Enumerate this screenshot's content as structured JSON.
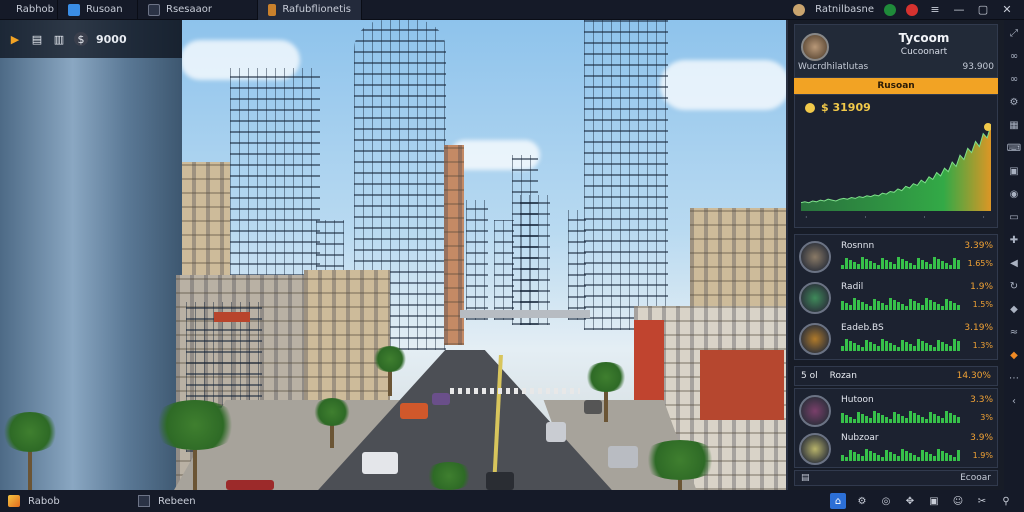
{
  "topbar": {
    "tabs": [
      {
        "label": "Rabhob",
        "icon": "app-logo-icon"
      },
      {
        "label": "Rusoan",
        "icon": "home-icon"
      },
      {
        "label": "Rsesaaor",
        "icon": "grid-icon"
      },
      {
        "label": "Rafubflionetis",
        "icon": "game-icon"
      }
    ],
    "account_label": "Ratnilbasne"
  },
  "hud": {
    "money": "9000"
  },
  "panel": {
    "title": "Tycoom",
    "subtitle": "Cucoonart",
    "stat_label": "Wucrdhilatlutas",
    "stat_value": "93.900",
    "banner": "Rusoan",
    "chart_value": "$ 31909",
    "assets_group1": [
      {
        "name": "Rosnnn",
        "val1": "3.39%",
        "val2": "1.65%",
        "icon_color": "#8a7a66"
      },
      {
        "name": "Radil",
        "val1": "1.9%",
        "val2": "1.5%",
        "icon_color": "#3f8a5a"
      },
      {
        "name": "Eadeb.BS",
        "val1": "3.19%",
        "val2": "1.3%",
        "icon_color": "#b07a2a"
      }
    ],
    "section2_label": "Rozan",
    "section2_prefix": "5 ol",
    "section2_value": "14.30%",
    "assets_group2": [
      {
        "name": "Hutoon",
        "val1": "3.3%",
        "val2": "3%",
        "icon_color": "#7a3f6a"
      },
      {
        "name": "Nubzoar",
        "val1": "3.9%",
        "val2": "1.9%",
        "icon_color": "#b8b36a"
      }
    ],
    "footer_label": "Ecooar"
  },
  "bottombar": {
    "tabs": [
      {
        "label": "Rabob",
        "icon": "app-logo-icon"
      },
      {
        "label": "Rebeen",
        "icon": "map-icon"
      }
    ]
  },
  "chart_data": {
    "type": "area",
    "values": [
      5,
      6,
      5,
      7,
      6,
      8,
      7,
      9,
      8,
      7,
      9,
      10,
      9,
      11,
      10,
      12,
      11,
      13,
      12,
      14,
      13,
      16,
      15,
      18,
      17,
      21,
      19,
      24,
      22,
      27,
      25,
      31,
      28,
      35,
      32,
      40,
      36,
      45,
      41,
      52,
      47,
      60,
      55,
      68,
      63,
      76,
      70,
      85,
      80,
      95
    ],
    "grid": false
  },
  "colors": {
    "accent": "#f2a324",
    "positive": "#37c14a",
    "value_text": "#f0a235"
  }
}
